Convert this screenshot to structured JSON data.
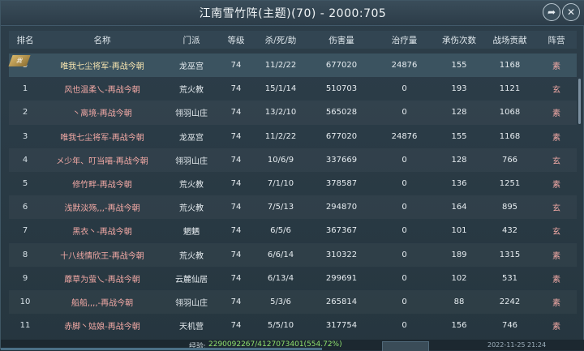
{
  "window": {
    "title": "江南雪竹阵(主题)(70) - 2000:705",
    "share_icon": "share-arrow-icon",
    "close_icon": "close-icon"
  },
  "table": {
    "columns": [
      "排名",
      "名称",
      "门派",
      "等级",
      "杀/死/助",
      "伤害量",
      "治疗量",
      "承伤次数",
      "战场贡献",
      "阵营"
    ],
    "rows": [
      [
        "3",
        "唯我七尘将军-再战今朝",
        "龙巫宫",
        "74",
        "11/2/22",
        "677020",
        "24876",
        "155",
        "1168",
        "素"
      ],
      [
        "1",
        "风也温柔乀-再战今朝",
        "荒火教",
        "74",
        "15/1/14",
        "510703",
        "0",
        "193",
        "1121",
        "玄"
      ],
      [
        "2",
        "丶离境-再战今朝",
        "翎羽山庄",
        "74",
        "13/2/10",
        "565028",
        "0",
        "128",
        "1068",
        "素"
      ],
      [
        "3",
        "唯我七尘将军-再战今朝",
        "龙巫宫",
        "74",
        "11/2/22",
        "677020",
        "24876",
        "155",
        "1168",
        "素"
      ],
      [
        "4",
        "メ少年、叮当喵-再战今朝",
        "翎羽山庄",
        "74",
        "10/6/9",
        "337669",
        "0",
        "128",
        "766",
        "玄"
      ],
      [
        "5",
        "修竹畔-再战今朝",
        "荒火教",
        "74",
        "7/1/10",
        "378587",
        "0",
        "136",
        "1251",
        "素"
      ],
      [
        "6",
        "浅默淡殇,,,-再战今朝",
        "荒火教",
        "74",
        "7/5/13",
        "294870",
        "0",
        "164",
        "895",
        "玄"
      ],
      [
        "7",
        "黑衣丶-再战今朝",
        "魍魉",
        "74",
        "6/5/6",
        "367367",
        "0",
        "101",
        "432",
        "玄"
      ],
      [
        "8",
        "十八线情欣王-再战今朝",
        "荒火教",
        "74",
        "6/6/14",
        "310322",
        "0",
        "189",
        "1315",
        "素"
      ],
      [
        "9",
        "蘼草为萤乀-再战今朝",
        "云麓仙居",
        "74",
        "6/13/4",
        "299691",
        "0",
        "102",
        "531",
        "素"
      ],
      [
        "10",
        "船船,,,,-再战今朝",
        "翎羽山庄",
        "74",
        "5/3/6",
        "265814",
        "0",
        "88",
        "2242",
        "素"
      ],
      [
        "11",
        "赤脚丶姑娘-再战今朝",
        "天机营",
        "74",
        "5/5/10",
        "317754",
        "0",
        "156",
        "746",
        "素"
      ]
    ],
    "badge_text": "我"
  },
  "footer": {
    "exp_label": "经验:",
    "exp_value": "2290092267/4127073401(554.72%)",
    "exp_fraction": 0.55,
    "clock": "2022-11-25 21:24"
  }
}
